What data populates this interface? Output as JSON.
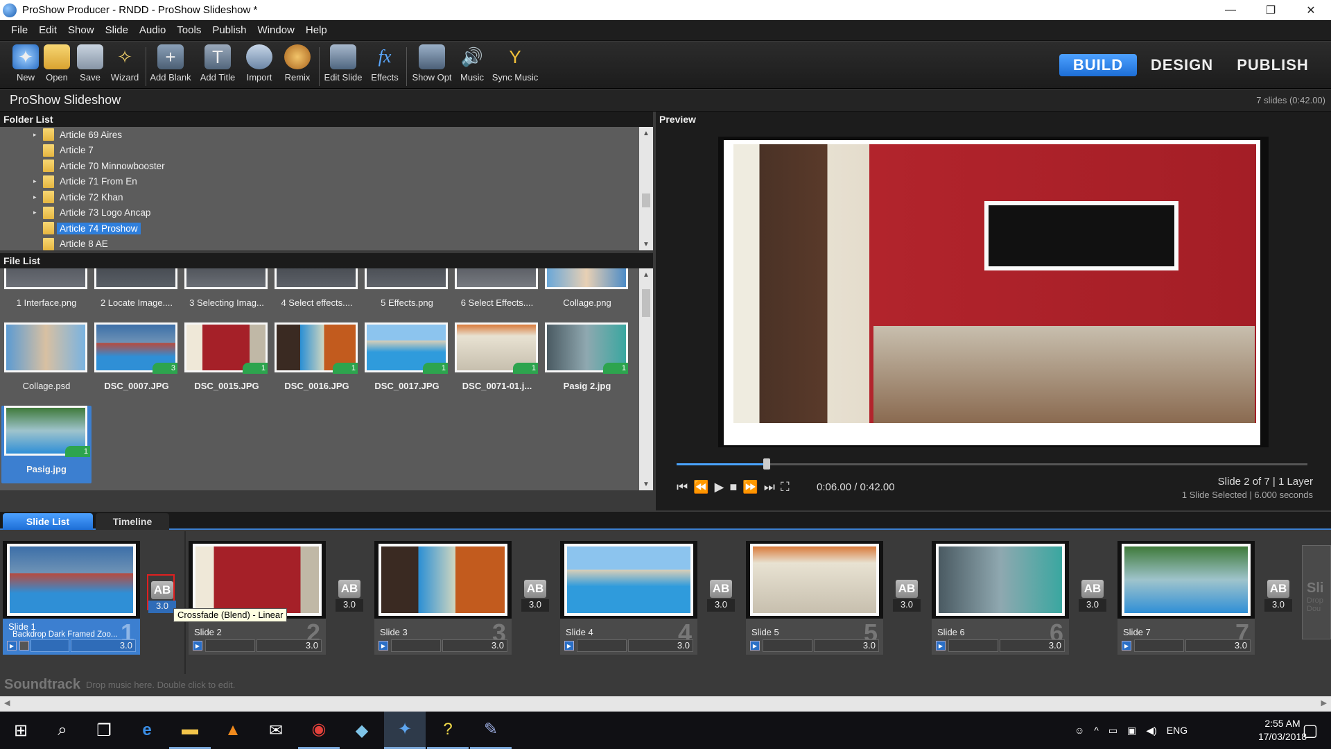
{
  "window": {
    "title": "ProShow Producer - RNDD - ProShow Slideshow *",
    "minimize": "—",
    "restore": "❐",
    "close": "✕"
  },
  "menu": [
    "File",
    "Edit",
    "Show",
    "Slide",
    "Audio",
    "Tools",
    "Publish",
    "Window",
    "Help"
  ],
  "toolbar": {
    "buttons": [
      {
        "label": "New",
        "icon": "new-icon"
      },
      {
        "label": "Open",
        "icon": "open-folder-icon"
      },
      {
        "label": "Save",
        "icon": "save-icon"
      },
      {
        "label": "Wizard",
        "icon": "wizard-icon"
      },
      {
        "label": "Add Blank",
        "icon": "add-blank-icon"
      },
      {
        "label": "Add Title",
        "icon": "add-title-icon"
      },
      {
        "label": "Import",
        "icon": "import-icon"
      },
      {
        "label": "Remix",
        "icon": "remix-icon"
      },
      {
        "label": "Edit Slide",
        "icon": "edit-slide-icon"
      },
      {
        "label": "Effects",
        "icon": "effects-icon"
      },
      {
        "label": "Show Opt",
        "icon": "show-options-icon"
      },
      {
        "label": "Music",
        "icon": "music-icon"
      },
      {
        "label": "Sync Music",
        "icon": "sync-music-icon"
      }
    ],
    "modes": {
      "build": "BUILD",
      "design": "DESIGN",
      "publish": "PUBLISH",
      "active": "build"
    }
  },
  "show": {
    "title": "ProShow Slideshow",
    "count": "7 slides (0:42.00)"
  },
  "folder_list": {
    "header": "Folder List",
    "items": [
      {
        "name": "Article 69 Aires",
        "expandable": true
      },
      {
        "name": "Article 7",
        "expandable": false
      },
      {
        "name": "Article 70 Minnowbooster",
        "expandable": false
      },
      {
        "name": "Article 71 From En",
        "expandable": true
      },
      {
        "name": "Article 72 Khan",
        "expandable": true
      },
      {
        "name": "Article 73 Logo Ancap",
        "expandable": true
      },
      {
        "name": "Article 74 Proshow",
        "expandable": false,
        "selected": true
      },
      {
        "name": "Article 8 AE",
        "expandable": false
      }
    ]
  },
  "file_list": {
    "header": "File List",
    "items": [
      {
        "name": "1 Interface.png",
        "used": ""
      },
      {
        "name": "2 Locate Image....",
        "used": ""
      },
      {
        "name": "3 Selecting Imag...",
        "used": ""
      },
      {
        "name": "4 Select effects....",
        "used": ""
      },
      {
        "name": "5 Effects.png",
        "used": ""
      },
      {
        "name": "6 Select Effects....",
        "used": ""
      },
      {
        "name": "Collage.png",
        "used": ""
      },
      {
        "name": "Collage.psd",
        "used": ""
      },
      {
        "name": "DSC_0007.JPG",
        "used": "3"
      },
      {
        "name": "DSC_0015.JPG",
        "used": "1"
      },
      {
        "name": "DSC_0016.JPG",
        "used": "1"
      },
      {
        "name": "DSC_0017.JPG",
        "used": "1"
      },
      {
        "name": "DSC_0071-01.j...",
        "used": "1"
      },
      {
        "name": "Pasig 2.jpg",
        "used": "1"
      },
      {
        "name": "Pasig.jpg",
        "used": "1"
      }
    ]
  },
  "preview": {
    "header": "Preview",
    "time": "0:06.00 / 0:42.00",
    "progress": 0.143,
    "info1": "Slide 2 of 7  |  1 Layer",
    "info2": "1 Slide Selected  |  6.000 seconds",
    "controls": [
      "⏮",
      "⏪",
      "▶",
      "■",
      "⏩",
      "⏭",
      "⛶"
    ]
  },
  "tabs": {
    "slide_list": "Slide List",
    "timeline": "Timeline"
  },
  "slides": [
    {
      "name": "Slide 1",
      "num": "1",
      "sub": "Backdrop Dark Framed Zoo...",
      "duration": "3.0",
      "transition": "3.0"
    },
    {
      "name": "Slide 2",
      "num": "2",
      "duration": "3.0",
      "transition": "3.0"
    },
    {
      "name": "Slide 3",
      "num": "3",
      "duration": "3.0",
      "transition": "3.0"
    },
    {
      "name": "Slide 4",
      "num": "4",
      "duration": "3.0",
      "transition": "3.0"
    },
    {
      "name": "Slide 5",
      "num": "5",
      "duration": "3.0",
      "transition": "3.0"
    },
    {
      "name": "Slide 6",
      "num": "6",
      "duration": "3.0",
      "transition": "3.0"
    },
    {
      "name": "Slide 7",
      "num": "7",
      "duration": "3.0",
      "transition": "3.0"
    }
  ],
  "transition_label": "AB",
  "tooltip": "Crossfade (Blend) - Linear",
  "next_card": {
    "title": "Sli",
    "line1": "Drop",
    "line2": "Dou"
  },
  "soundtrack": {
    "label": "Soundtrack",
    "hint": "Drop music here.  Double click to edit."
  },
  "taskbar": {
    "apps": [
      "windows-start-icon",
      "search-icon",
      "task-view-icon",
      "edge-icon",
      "file-explorer-icon",
      "vlc-icon",
      "mail-icon",
      "chrome-icon",
      "notes-icon",
      "proshow-icon",
      "sticky-notes-icon",
      "paint-icon"
    ],
    "lang": "ENG",
    "time": "2:55 AM",
    "date": "17/03/2018"
  },
  "colors": {
    "accent": "#3c7fd0",
    "build": "#1d6ed6",
    "selected_transition_outline": "#e02020"
  }
}
